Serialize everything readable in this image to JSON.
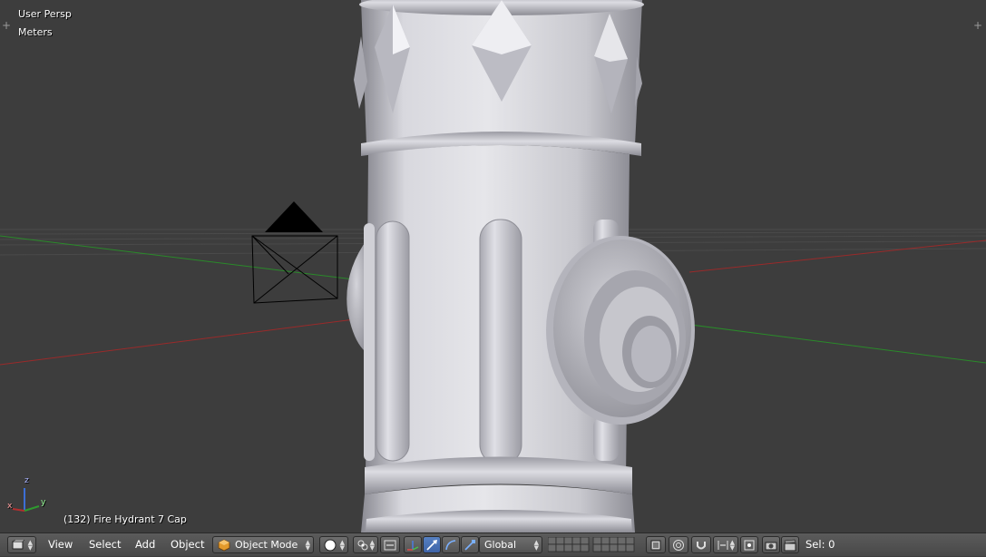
{
  "viewport": {
    "view_name": "User Persp",
    "units": "Meters",
    "object_info": "(132) Fire Hydrant 7 Cap",
    "axis_labels": {
      "x": "x",
      "y": "y",
      "z": "z"
    }
  },
  "header": {
    "editor_type_icon": "3d-view-icon",
    "menus": [
      "View",
      "Select",
      "Add",
      "Object"
    ],
    "mode": {
      "label": "Object Mode",
      "icon": "cube-icon"
    },
    "shading_icon": "solid-sphere-icon",
    "pivot_icon": "pivot-point-icon",
    "manipulator_icon": "manipulator-toggle-icon",
    "transform_icons": [
      "translate-icon",
      "rotate-icon",
      "scale-icon"
    ],
    "orientation": "Global",
    "layers_icon": "layers-grid-icon",
    "status": "Sel: 0"
  },
  "colors": {
    "background": "#3d3d3d",
    "header": "#4f4f4f",
    "active_button": "#5680c2",
    "x_axis": "#b03030",
    "y_axis": "#2f9a2f",
    "z_axis": "#3c6ed6"
  }
}
